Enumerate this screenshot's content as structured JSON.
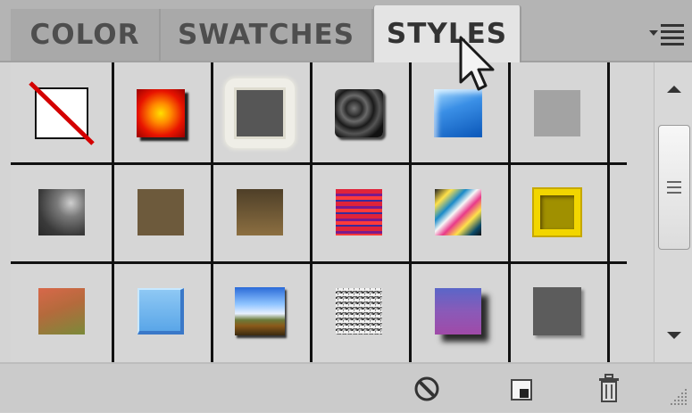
{
  "tabs": [
    {
      "label": "COLOR",
      "active": false
    },
    {
      "label": "SWATCHES",
      "active": false
    },
    {
      "label": "STYLES",
      "active": true
    }
  ],
  "menu": {
    "icon": "panel-menu-icon"
  },
  "styles_grid": {
    "columns": 6,
    "rows": 3,
    "items": [
      {
        "name": "no-style",
        "kind": "none"
      },
      {
        "name": "red-glow",
        "kind": "style"
      },
      {
        "name": "gray-outer-glow",
        "kind": "style"
      },
      {
        "name": "dark-rings",
        "kind": "style"
      },
      {
        "name": "blue-glass",
        "kind": "style"
      },
      {
        "name": "flat-gray",
        "kind": "style"
      },
      {
        "name": "dark-smoke",
        "kind": "style"
      },
      {
        "name": "olive-flat",
        "kind": "style"
      },
      {
        "name": "brown-gradient",
        "kind": "style"
      },
      {
        "name": "red-stripes",
        "kind": "style"
      },
      {
        "name": "multicolor-swirl",
        "kind": "style"
      },
      {
        "name": "gold-bevel",
        "kind": "style"
      },
      {
        "name": "sunset-gradient",
        "kind": "style"
      },
      {
        "name": "light-blue-bevel",
        "kind": "style"
      },
      {
        "name": "sky-landscape",
        "kind": "style"
      },
      {
        "name": "noise-texture",
        "kind": "style"
      },
      {
        "name": "purple-drop-shadow",
        "kind": "style"
      },
      {
        "name": "dark-gray-shadow",
        "kind": "style"
      }
    ]
  },
  "footer": {
    "buttons": [
      {
        "name": "clear-style-button",
        "icon": "clear-style-icon"
      },
      {
        "name": "new-style-button",
        "icon": "new-item-icon"
      },
      {
        "name": "delete-style-button",
        "icon": "trash-icon"
      }
    ]
  }
}
